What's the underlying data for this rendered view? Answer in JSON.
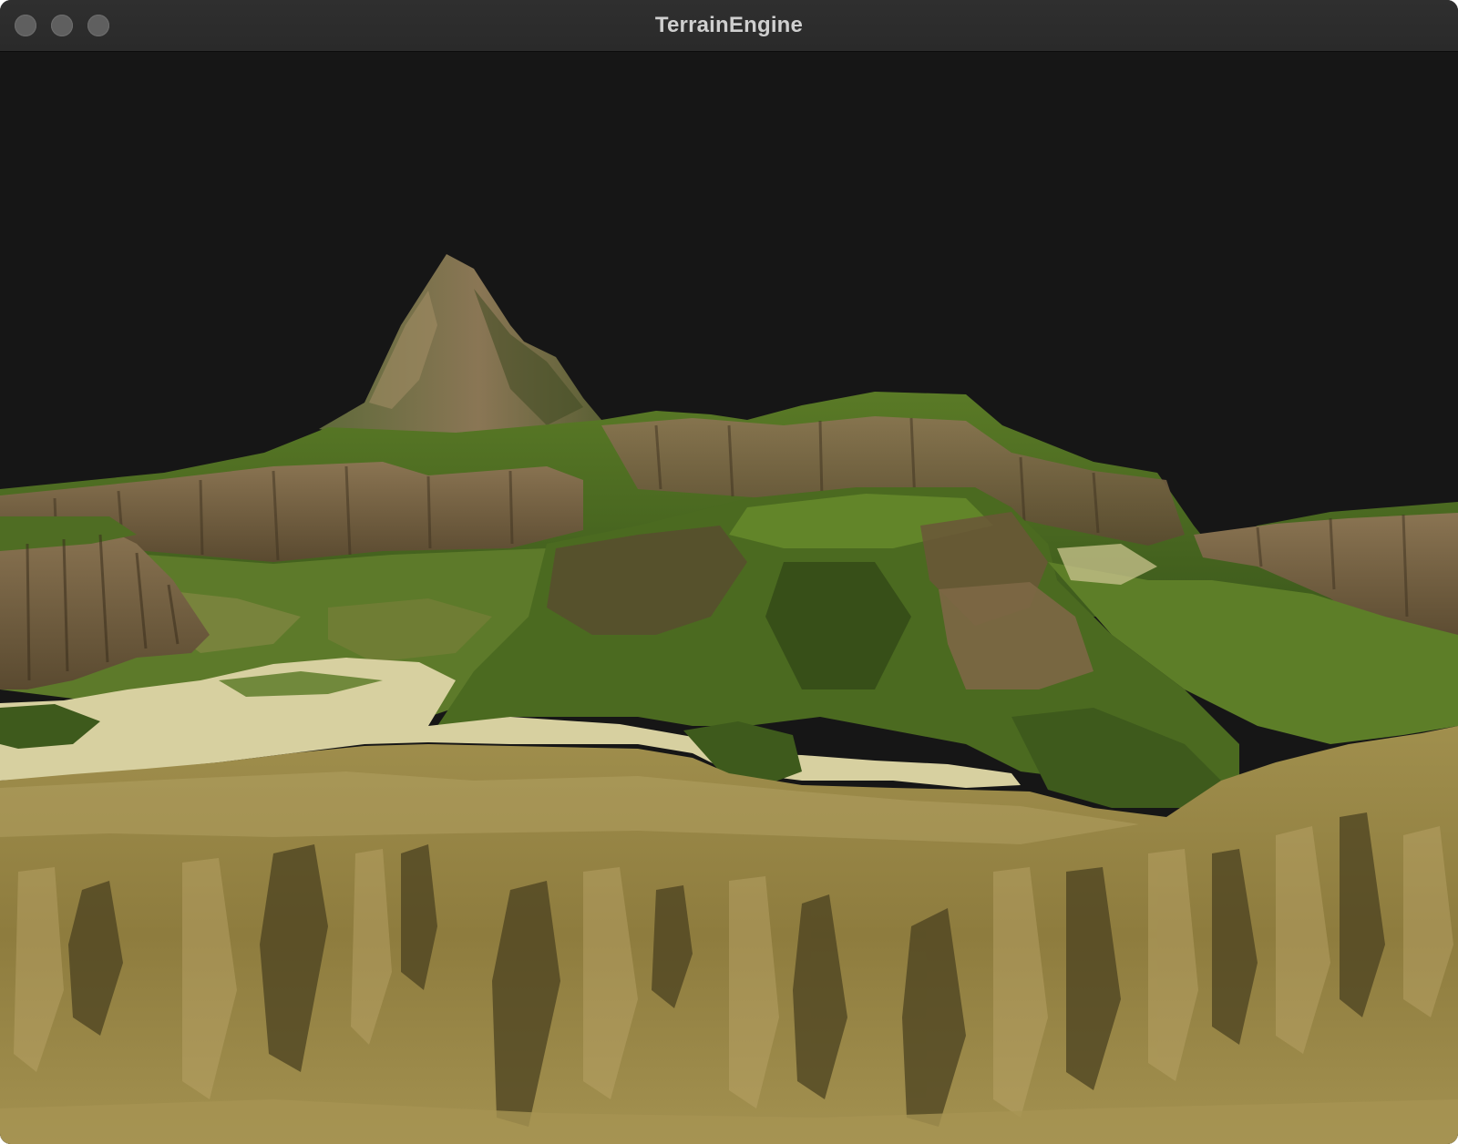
{
  "window": {
    "title": "TerrainEngine",
    "controls": [
      "close",
      "minimize",
      "maximize"
    ]
  },
  "viewport": {
    "clear_color": "#161616",
    "scene": "3d-terrain-render",
    "palette": {
      "grass": "#4f6b22",
      "grass_dark": "#2f4416",
      "rock": "#6e5a3c",
      "rock_light": "#9a8560",
      "sand": "#d6cf9f",
      "dirt": "#9c8a48",
      "cliff_shadow": "#4b4220"
    }
  }
}
